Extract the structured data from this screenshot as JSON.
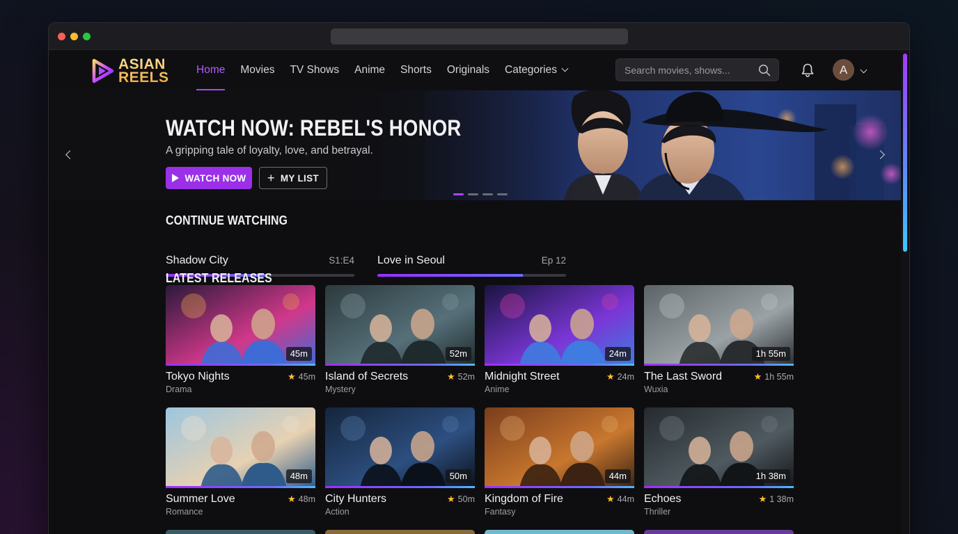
{
  "nav": {
    "logo_line1": "ASIAN",
    "logo_line2": "REELS",
    "links": [
      "Home",
      "Movies",
      "TV Shows",
      "Anime",
      "Shorts",
      "Originals",
      "Categories"
    ],
    "active_index": 0,
    "search_placeholder": "Search movies, shows...",
    "avatar_letter": "A"
  },
  "hero": {
    "title": "WATCH NOW: REBEL'S HONOR",
    "subtitle": "A gripping tale of loyalty, love, and betrayal.",
    "watch_label": "WATCH NOW",
    "list_label": "MY LIST",
    "slide_count": 4,
    "active_slide": 0
  },
  "continue_watching": {
    "title": "CONTINUE WATCHING",
    "items": [
      {
        "title": "Shadow City",
        "episode": "S1:E4",
        "progress": 0.54
      },
      {
        "title": "Love in Seoul",
        "episode": "Ep 12",
        "progress": 0.77
      }
    ]
  },
  "latest": {
    "title": "LATEST RELEASES",
    "items": [
      {
        "title": "Tokyo Nights",
        "genre": "Drama",
        "duration": "45m",
        "rating": "45m",
        "palette": [
          "#2a1a3a",
          "#d1388a",
          "#3f6bd6",
          "#f3b04a"
        ]
      },
      {
        "title": "Island of Secrets",
        "genre": "Mystery",
        "duration": "52m",
        "rating": "52m",
        "palette": [
          "#2c3a3d",
          "#56707a",
          "#1f2a2c",
          "#8aa0a6"
        ]
      },
      {
        "title": "Midnight Street",
        "genre": "Anime",
        "duration": "24m",
        "rating": "24m",
        "palette": [
          "#1a1440",
          "#7a36d6",
          "#3f7be0",
          "#e13fa8"
        ]
      },
      {
        "title": "The Last Sword",
        "genre": "Wuxia",
        "duration": "1h 55m",
        "rating": "1h 55m",
        "palette": [
          "#5d6468",
          "#9aa2a6",
          "#2a2d30",
          "#c7ccce"
        ]
      },
      {
        "title": "Summer Love",
        "genre": "Romance",
        "duration": "48m",
        "rating": "48m",
        "palette": [
          "#9cc6e0",
          "#e7d1b2",
          "#2f5b8a",
          "#f2e6d4"
        ]
      },
      {
        "title": "City Hunters",
        "genre": "Action",
        "duration": "50m",
        "rating": "50m",
        "palette": [
          "#15253c",
          "#2d4f80",
          "#0b111b",
          "#5c85b8"
        ]
      },
      {
        "title": "Kingdom of Fire",
        "genre": "Fantasy",
        "duration": "44m",
        "rating": "44m",
        "palette": [
          "#7a3d1c",
          "#c8772e",
          "#3b2212",
          "#e9b072"
        ]
      },
      {
        "title": "Echoes",
        "genre": "Thriller",
        "duration": "1h 38m",
        "rating": "1 38m",
        "palette": [
          "#252a2e",
          "#4f5a60",
          "#121517",
          "#7a868c"
        ]
      }
    ],
    "peek_colors": [
      "#3a5c66",
      "#8a6a3a",
      "#6fb8d0",
      "#6a3a9a"
    ]
  },
  "colors": {
    "accent": "#a847ff",
    "background": "#0e0e11",
    "star": "#ffc12e"
  }
}
